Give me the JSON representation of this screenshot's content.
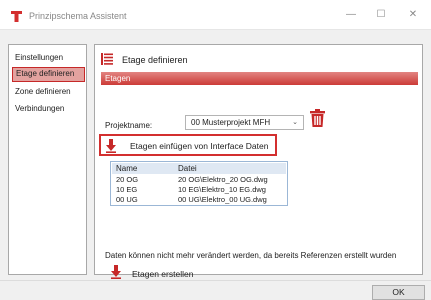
{
  "window": {
    "title": "Prinzipschema Assistent",
    "minimize_glyph": "—",
    "maximize_glyph": "☐",
    "close_glyph": "✕"
  },
  "sidebar": {
    "items": [
      {
        "label": "Einstellungen",
        "active": false
      },
      {
        "label": "Etage definieren",
        "active": true
      },
      {
        "label": "Zone definieren",
        "active": false
      },
      {
        "label": "Verbindungen",
        "active": false
      }
    ]
  },
  "main": {
    "header_title": "Etage definieren",
    "section_title": "Etagen",
    "project_label": "Projektname:",
    "project_value": "00 Musterprojekt MFH",
    "insert_button_label": "Etagen einfügen von Interface Daten",
    "table": {
      "columns": [
        "Name",
        "Datei"
      ],
      "rows": [
        [
          "20 OG",
          "20 OG\\Elektro_20 OG.dwg"
        ],
        [
          "10 EG",
          "10 EG\\Elektro_10 EG.dwg"
        ],
        [
          "00 UG",
          "00 UG\\Elektro_00 UG.dwg"
        ]
      ]
    },
    "info_text": "Daten können nicht mehr verändert werden, da bereits Referenzen erstellt wurden",
    "create_button_label": "Etagen erstellen"
  },
  "footer": {
    "ok_label": "OK"
  },
  "colors": {
    "accent": "#c62828",
    "band_top": "#e28582",
    "band_bottom": "#cc3b37",
    "active_nav_bg": "#e3a29f"
  },
  "icons": {
    "app": "red-t-icon",
    "header": "list-icon",
    "trash": "trash-icon",
    "insert": "down-arrow-icon",
    "create": "down-arrow-icon",
    "chevron": "chevron-down-icon"
  }
}
